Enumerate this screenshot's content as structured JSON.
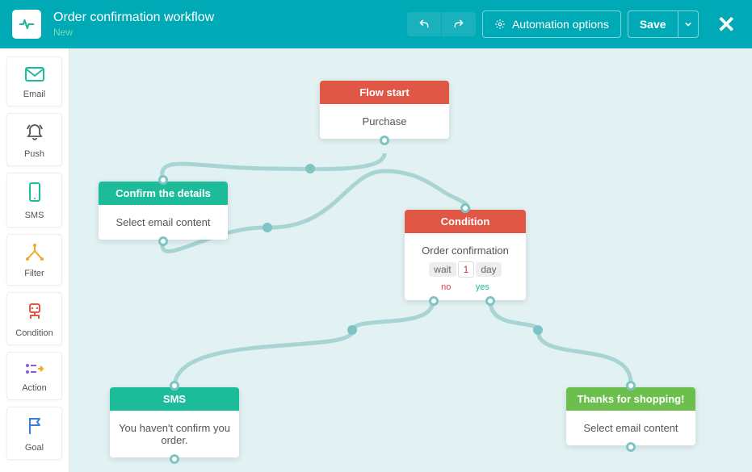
{
  "header": {
    "title": "Order confirmation workflow",
    "status": "New",
    "automation_options": "Automation options",
    "save": "Save"
  },
  "sidebar": {
    "items": [
      {
        "label": "Email"
      },
      {
        "label": "Push"
      },
      {
        "label": "SMS"
      },
      {
        "label": "Filter"
      },
      {
        "label": "Condition"
      },
      {
        "label": "Action"
      },
      {
        "label": "Goal"
      }
    ]
  },
  "nodes": {
    "start": {
      "title": "Flow start",
      "body": "Purchase"
    },
    "confirm": {
      "title": "Confirm the details",
      "body": "Select email content"
    },
    "condition": {
      "title": "Condition",
      "body": "Order confirmation",
      "wait": {
        "w": "wait",
        "n": "1",
        "d": "day"
      },
      "no": "no",
      "yes": "yes"
    },
    "sms": {
      "title": "SMS",
      "body": "You haven't confirm you order."
    },
    "thanks": {
      "title": "Thanks for shopping!",
      "body": "Select email content"
    }
  },
  "colors": {
    "brand": "#00a9b6",
    "red": "#e05746",
    "teal": "#1cbc9b",
    "green": "#6cbf4c",
    "connector": "#a8d4d4"
  }
}
